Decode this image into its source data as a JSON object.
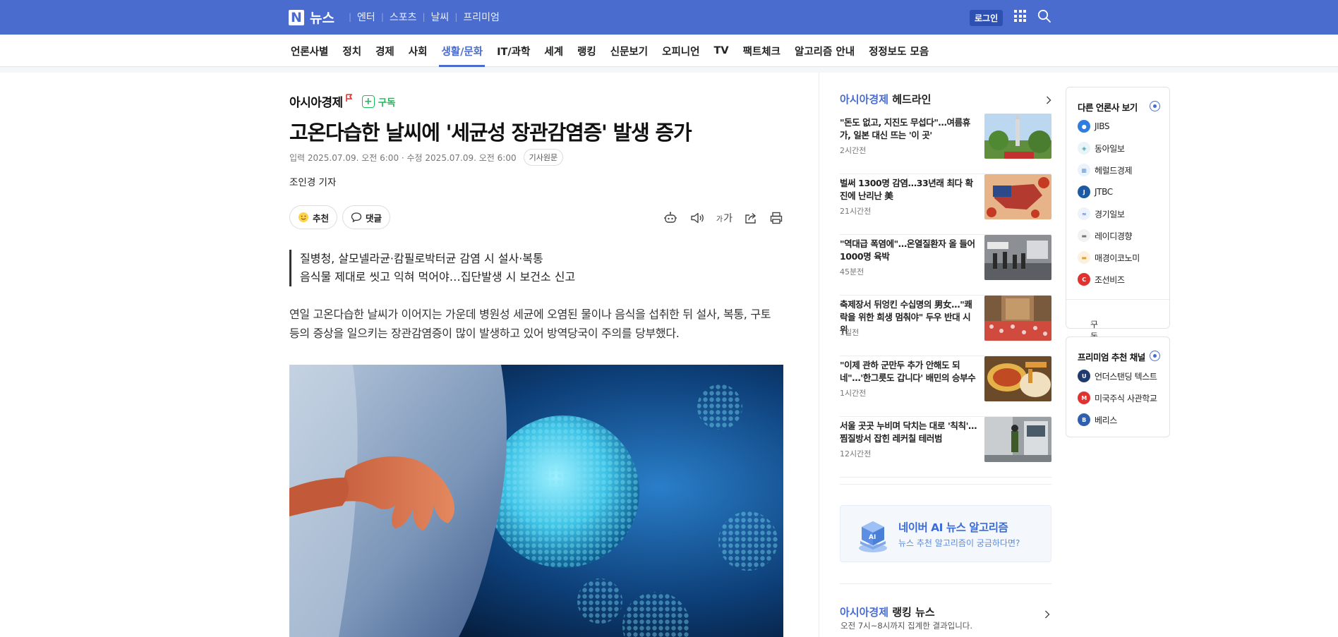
{
  "topbar": {
    "logo_letter": "N",
    "logo_text": "뉴스",
    "services": [
      "엔터",
      "스포츠",
      "날씨",
      "프리미엄"
    ],
    "login_label": "로그인"
  },
  "category_nav": {
    "items": [
      "언론사별",
      "정치",
      "경제",
      "사회",
      "생활/문화",
      "IT/과학",
      "세계",
      "랭킹",
      "신문보기",
      "오피니언",
      "TV",
      "팩트체크",
      "알고리즘 안내",
      "정정보도 모음"
    ],
    "active": "생활/문화"
  },
  "article": {
    "press_name": "아시아경제",
    "subscribe_label": "구독",
    "headline": "고온다습한 날씨에 '세균성 장관감염증' 발생 증가",
    "dates": "입력 2025.07.09. 오전 6:00 · 수정 2025.07.09. 오전 6:00",
    "source_label": "기사원문",
    "reporter": "조인경 기자",
    "recommend_label": "추천",
    "comment_label": "댓글",
    "font_tool_label": "가",
    "summary": [
      "질병청, 살모넬라균·캄필로박터균 감염 시 설사·복통",
      "음식물 제대로 씻고 익혀 먹어야…집단발생 시 보건소 신고"
    ],
    "body_paragraph": "연일 고온다습한 날씨가 이어지는 가운데 병원성 세균에 오염된 물이나 음식을 섭취한 뒤 설사, 복통, 구토 등의 증상을 일으키는 장관감염증이 많이 발생하고 있어 방역당국이 주의를 당부했다."
  },
  "headlines": {
    "press_name": "아시아경제",
    "title_suffix": " 헤드라인",
    "items": [
      {
        "text": "\"돈도 없고, 지진도 무섭다\"…여름휴가, 일본 대신 뜨는 '이 곳'",
        "time": "2시간전"
      },
      {
        "text": "벌써 1300명 감염…33년래 최다 확진에 난리난 美",
        "time": "21시간전"
      },
      {
        "text": "\"역대급 폭염에\"…온열질환자 올 들어 1000명 육박",
        "time": "45분전"
      },
      {
        "text": "축제장서 뒤엉킨 수십명의 男女…\"쾌락을 위한 희생 멈춰야\" 두우 반대 시위",
        "time": "1일전"
      },
      {
        "text": "\"이제 관하 군만두 추가 안해도 되네\"…'한그릇도 갑니다' 배민의 승부수",
        "time": "1시간전"
      },
      {
        "text": "서울 곳곳 누비며 닥치는 대로 '칙칙'…찜질방서 잡힌 레커칠 테러범",
        "time": "12시간전"
      }
    ]
  },
  "ai_banner": {
    "title": "네이버 AI 뉴스 알고리즘",
    "subtitle": "뉴스 추천 알고리즘이 궁금하다면?",
    "icon_text": "AI"
  },
  "ranking": {
    "press_name": "아시아경제",
    "title_suffix": " 랭킹 뉴스",
    "subtitle": "오전 7시~8시까지 집계한 결과입니다."
  },
  "other_press": {
    "title": "다른 언론사 보기",
    "items": [
      {
        "name": "JIBS",
        "color": "#2f7de1"
      },
      {
        "name": "동아일보",
        "color": "#7fc6d1"
      },
      {
        "name": "헤럴드경제",
        "color": "#a8c8e8"
      },
      {
        "name": "JTBC",
        "color": "#1c5aa6"
      },
      {
        "name": "경기일보",
        "color": "#5a7fc4"
      },
      {
        "name": "레이디경향",
        "color": "#8a8a8a"
      },
      {
        "name": "매경이코노미",
        "color": "#e0a030"
      },
      {
        "name": "조선비즈",
        "color": "#e0322f"
      }
    ],
    "footer_label": "구독 설정"
  },
  "premium": {
    "title": "프리미엄 추천 채널",
    "items": [
      {
        "name": "언더스탠딩 텍스트",
        "color": "#1e3a6e"
      },
      {
        "name": "미국주식 사관학교",
        "color": "#e0322f"
      },
      {
        "name": "베리스",
        "color": "#2f5fb0"
      }
    ]
  },
  "colors": {
    "brand_blue": "#4a6ccf",
    "subscribe_green": "#1dbc5b"
  }
}
